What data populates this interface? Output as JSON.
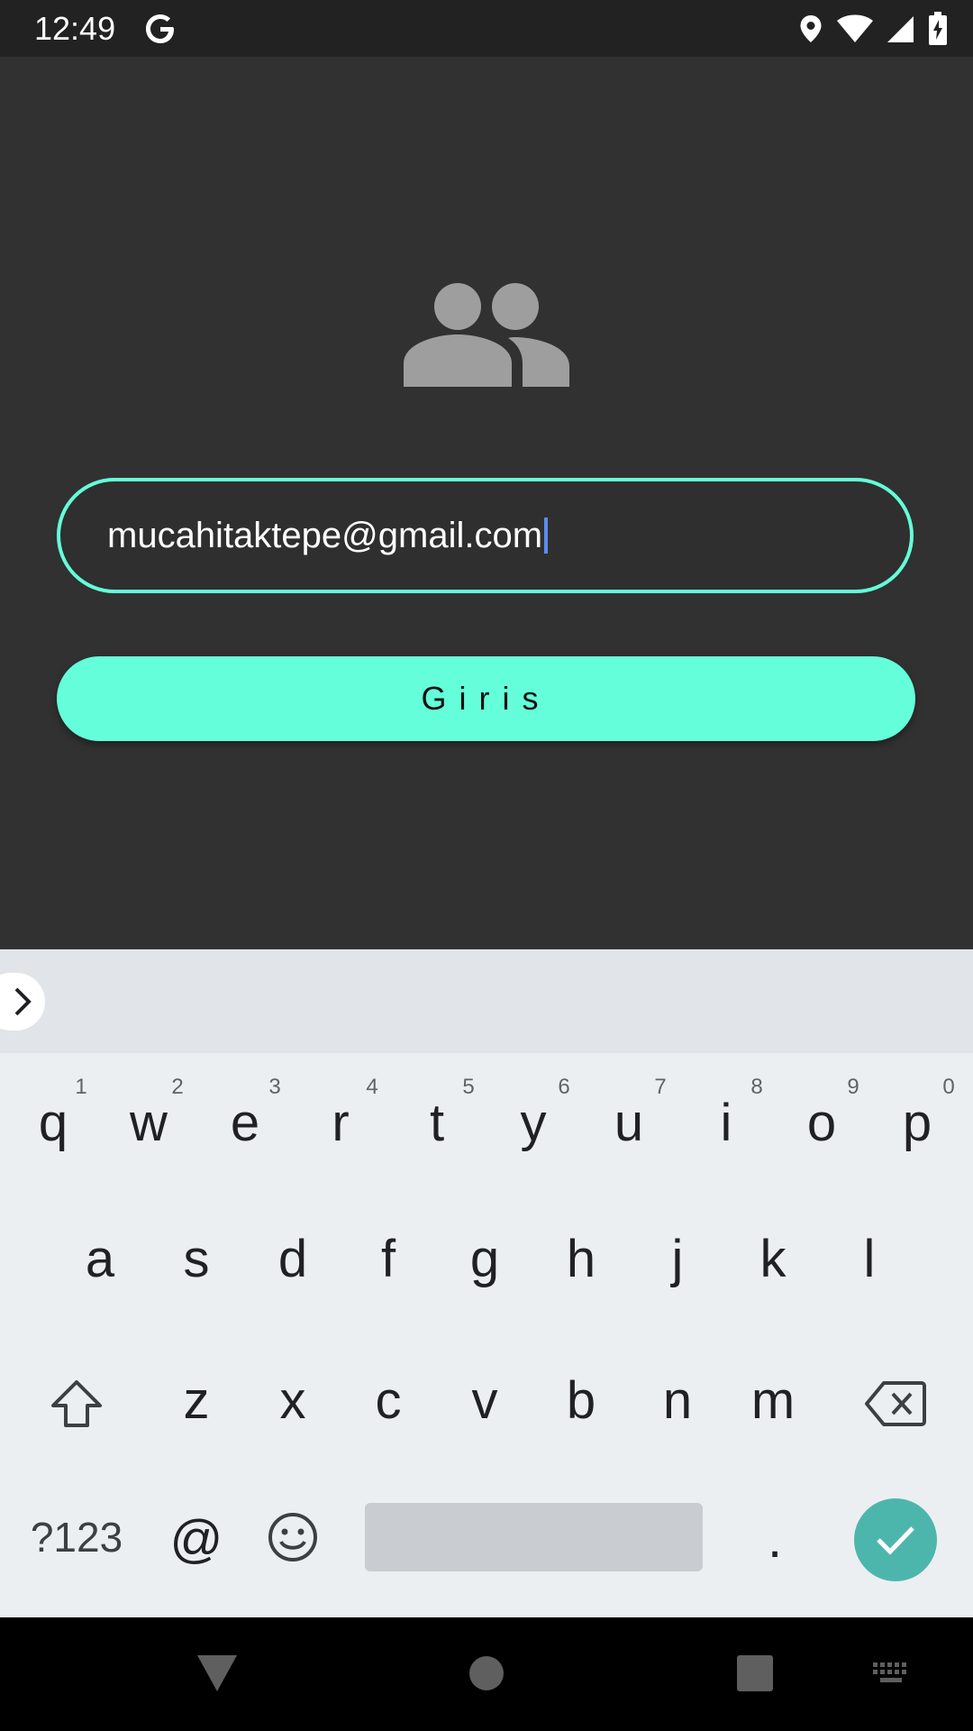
{
  "status_bar": {
    "time": "12:49",
    "icons": [
      "google-g-icon",
      "location-icon",
      "wifi-icon",
      "signal-icon",
      "battery-charging-icon"
    ]
  },
  "app": {
    "header_icon": "people-group-icon",
    "email_field": {
      "value": "mucahitaktepe@gmail.com"
    },
    "login_button": {
      "label": "Giris"
    },
    "colors": {
      "accent": "#64ffda",
      "background": "#313131"
    }
  },
  "keyboard": {
    "row1": [
      "q",
      "w",
      "e",
      "r",
      "t",
      "y",
      "u",
      "i",
      "o",
      "p"
    ],
    "row1_hints": [
      "1",
      "2",
      "3",
      "4",
      "5",
      "6",
      "7",
      "8",
      "9",
      "0"
    ],
    "row2": [
      "a",
      "s",
      "d",
      "f",
      "g",
      "h",
      "j",
      "k",
      "l"
    ],
    "row3": [
      "z",
      "x",
      "c",
      "v",
      "b",
      "n",
      "m"
    ],
    "symbols_key": "?123",
    "at_key": "@",
    "period_key": ".",
    "enter_color": "#4db6ac"
  },
  "nav_bar": {
    "buttons": [
      "back-icon",
      "home-icon",
      "recents-icon",
      "keyboard-switch-icon"
    ]
  }
}
